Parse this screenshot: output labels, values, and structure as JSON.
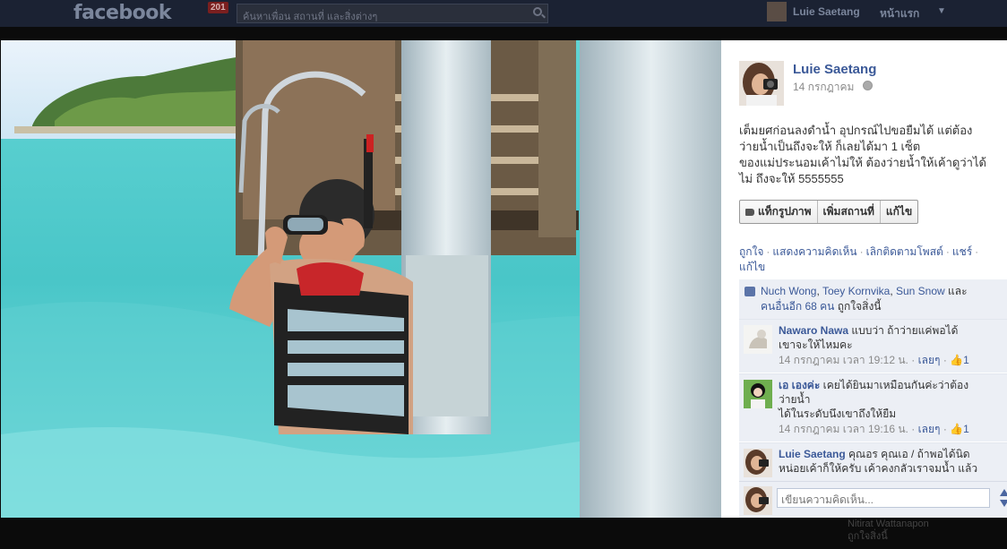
{
  "topbar": {
    "logo": "facebook",
    "notif_count": "201",
    "search_placeholder": "ค้นหาเพื่อน สถานที่ และสิ่งต่างๆ",
    "user_name": "Luie Saetang",
    "home_label": "หน้าแรก"
  },
  "post": {
    "owner_name": "Luie Saetang",
    "date": "14 กรกฎาคม",
    "caption_lines": [
      "เต็มยศก่อนลงดำน้ำ อุปกรณ์ไปขอยืมได้ แต่ต้อง",
      "ว่ายน้ำเป็นถึงจะให้ ก็เลยได้มา 1 เซ็ต",
      "ของแม่ประนอมเค้าไม่ให้ ต้องว่ายน้ำให้เค้าดูว่าได้",
      "ไม่ ถึงจะให้ 5555555"
    ],
    "tag_buttons": {
      "tag_photo": "แท็กรูปภาพ",
      "add_location": "เพิ่มสถานที่",
      "edit": "แก้ไข"
    },
    "actions": {
      "like": "ถูกใจ",
      "comment": "แสดงความคิดเห็น",
      "unfollow": "เลิกติดตามโพสต์",
      "share": "แชร์",
      "edit": "แก้ไข"
    },
    "likes": {
      "name1": "Nuch Wong",
      "name2": "Toey Kornvika",
      "name3": "Sun Snow",
      "and_text": "และ",
      "others": "คนอื่นอีก 68 คน",
      "suffix": "ถูกใจสิ่งนี้"
    }
  },
  "comments": [
    {
      "author": "Nawaro Nawa",
      "text1": "แบบว่า ถ้าว่ายแค่พอได้",
      "text2": "เขาจะให้ไหมคะ",
      "time": "14 กรกฎาคม เวลา 19:12 น.",
      "like_label": "เลยๆ",
      "like_count": "1"
    },
    {
      "author": "เอ เองค่ะ",
      "text1": "เคยได้ยินมาเหมือนกันค่ะว่าต้อง",
      "text2": "ว่ายน้ำ",
      "text3": "ได้ในระดับนึงเขาถึงให้ยืม",
      "time": "14 กรกฎาคม เวลา 19:16 น.",
      "like_label": "เลยๆ",
      "like_count": "1"
    },
    {
      "author": "Luie Saetang",
      "text1": "คุณอร คุณเอ / ถ้าพอได้นิด",
      "text2": "หน่อยเค้าก็ให้ครับ เค้าคงกลัวเราจมน้ำ แล้ว"
    }
  ],
  "composer": {
    "placeholder": "เขียนความคิดเห็น..."
  },
  "background_text": {
    "line1": "Nitirat Wattanapon",
    "line2": "ถูกใจสิ่งนี้"
  }
}
